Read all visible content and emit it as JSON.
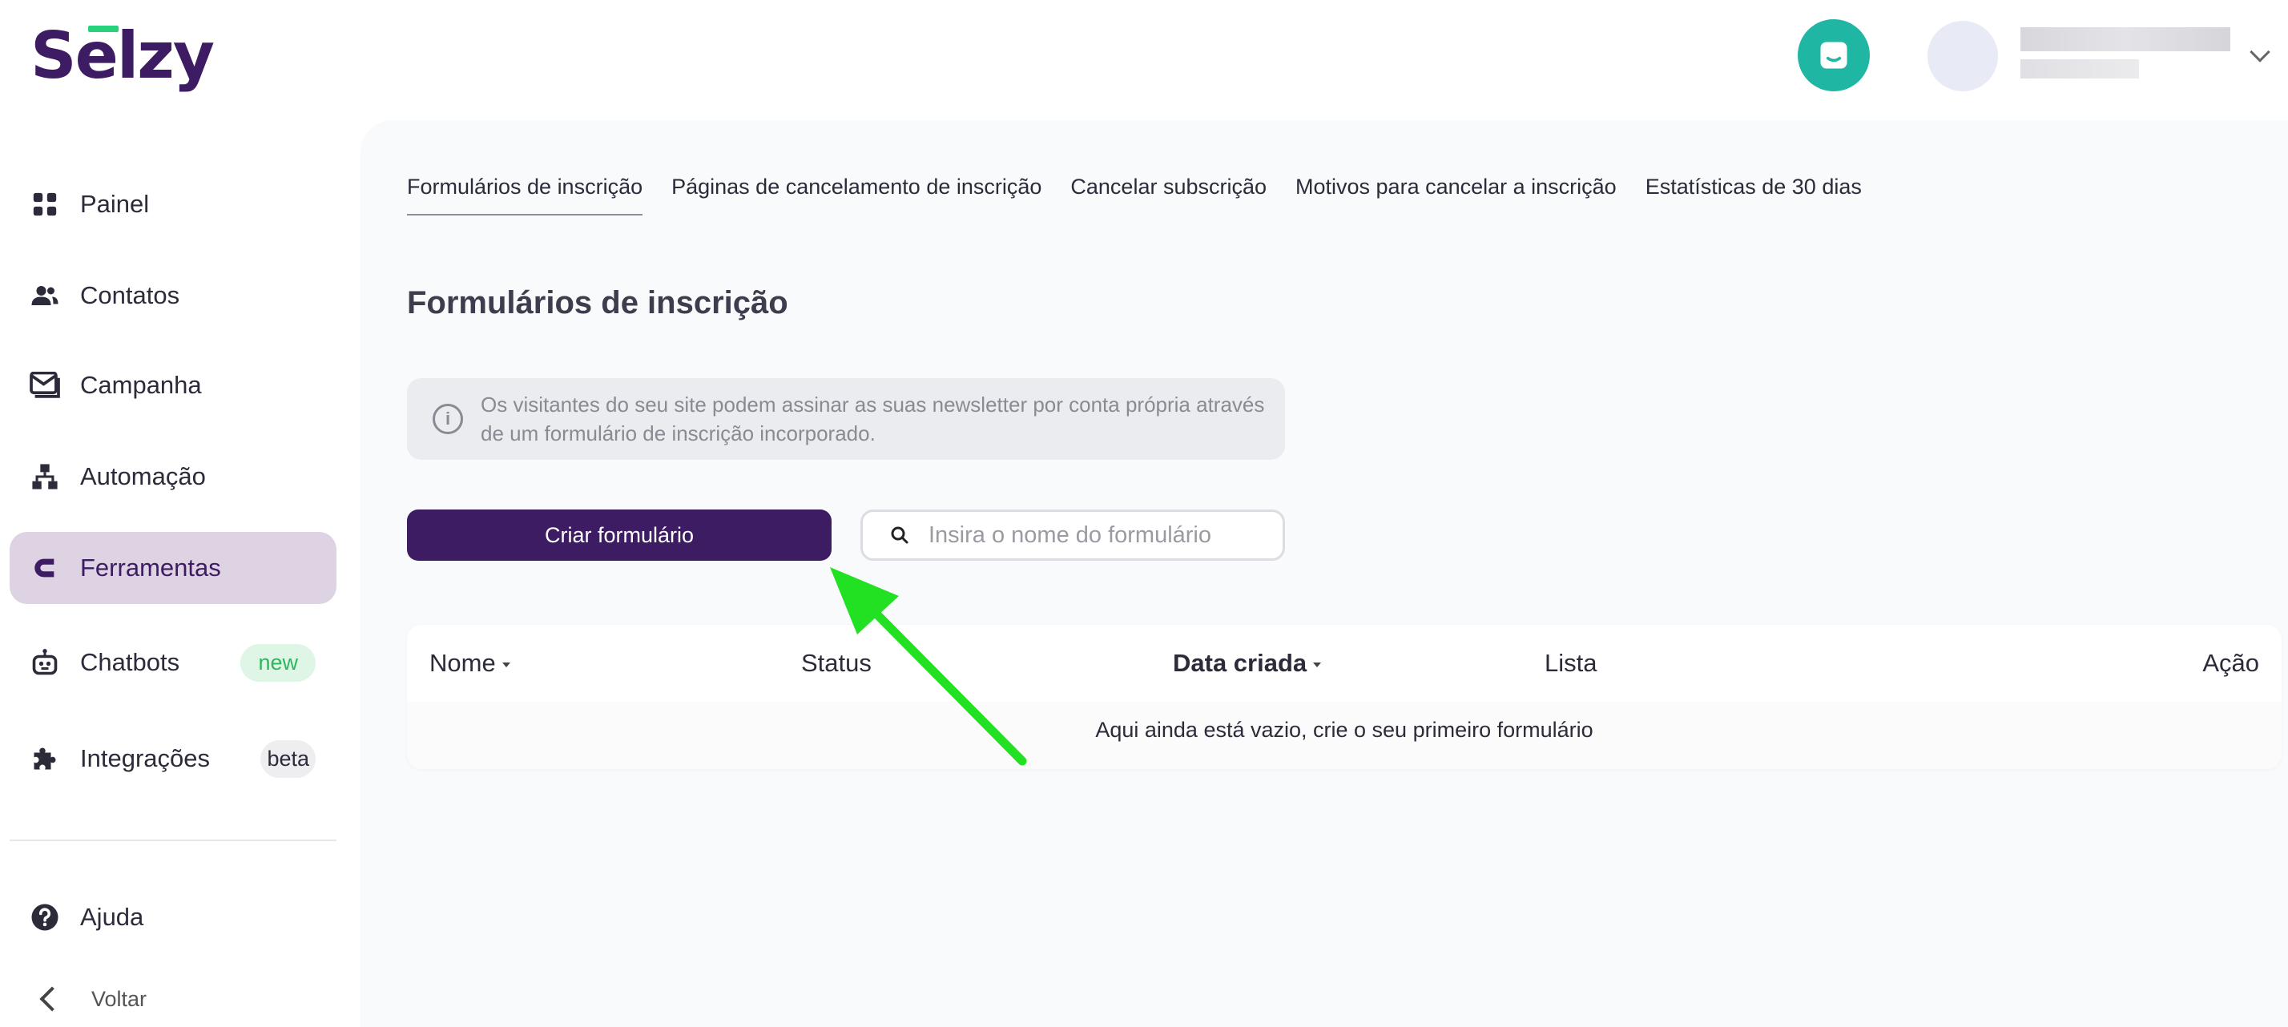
{
  "brand": {
    "logo_text": "Selzy",
    "brand_color": "#3d1c63",
    "accent_color": "#28d17c"
  },
  "header": {
    "support_icon": "chat-icon",
    "support_color": "#20b6a4",
    "user_menu_icon": "chevron-down-icon"
  },
  "sidebar": {
    "items": [
      {
        "label": "Painel",
        "icon": "dashboard-grid-icon"
      },
      {
        "label": "Contatos",
        "icon": "users-icon"
      },
      {
        "label": "Campanha",
        "icon": "envelope-icon"
      },
      {
        "label": "Automação",
        "icon": "workflow-icon"
      },
      {
        "label": "Ferramentas",
        "icon": "magnet-icon",
        "active": true
      },
      {
        "label": "Chatbots",
        "icon": "robot-icon",
        "badge": "new"
      },
      {
        "label": "Integrações",
        "icon": "puzzle-icon",
        "badge": "beta"
      }
    ],
    "help_label": "Ajuda",
    "back_label": "Voltar"
  },
  "tabs": [
    {
      "label": "Formulários de inscrição",
      "active": true
    },
    {
      "label": "Páginas de cancelamento de inscrição"
    },
    {
      "label": "Cancelar subscrição"
    },
    {
      "label": "Motivos para cancelar a inscrição"
    },
    {
      "label": "Estatísticas de 30 dias"
    }
  ],
  "main": {
    "title": "Formulários de inscrição",
    "info_text": "Os visitantes do seu site podem assinar as suas newsletter por conta própria através de um formulário de inscrição incorporado.",
    "create_button": "Criar formulário",
    "search_placeholder": "Insira o nome do formulário"
  },
  "table": {
    "columns": [
      "Nome",
      "Status",
      "Data criada",
      "Lista",
      "Ação"
    ],
    "empty_message": "Aqui ainda está vazio, crie o seu primeiro formulário"
  },
  "annotation": {
    "arrow_color": "#22e022"
  }
}
